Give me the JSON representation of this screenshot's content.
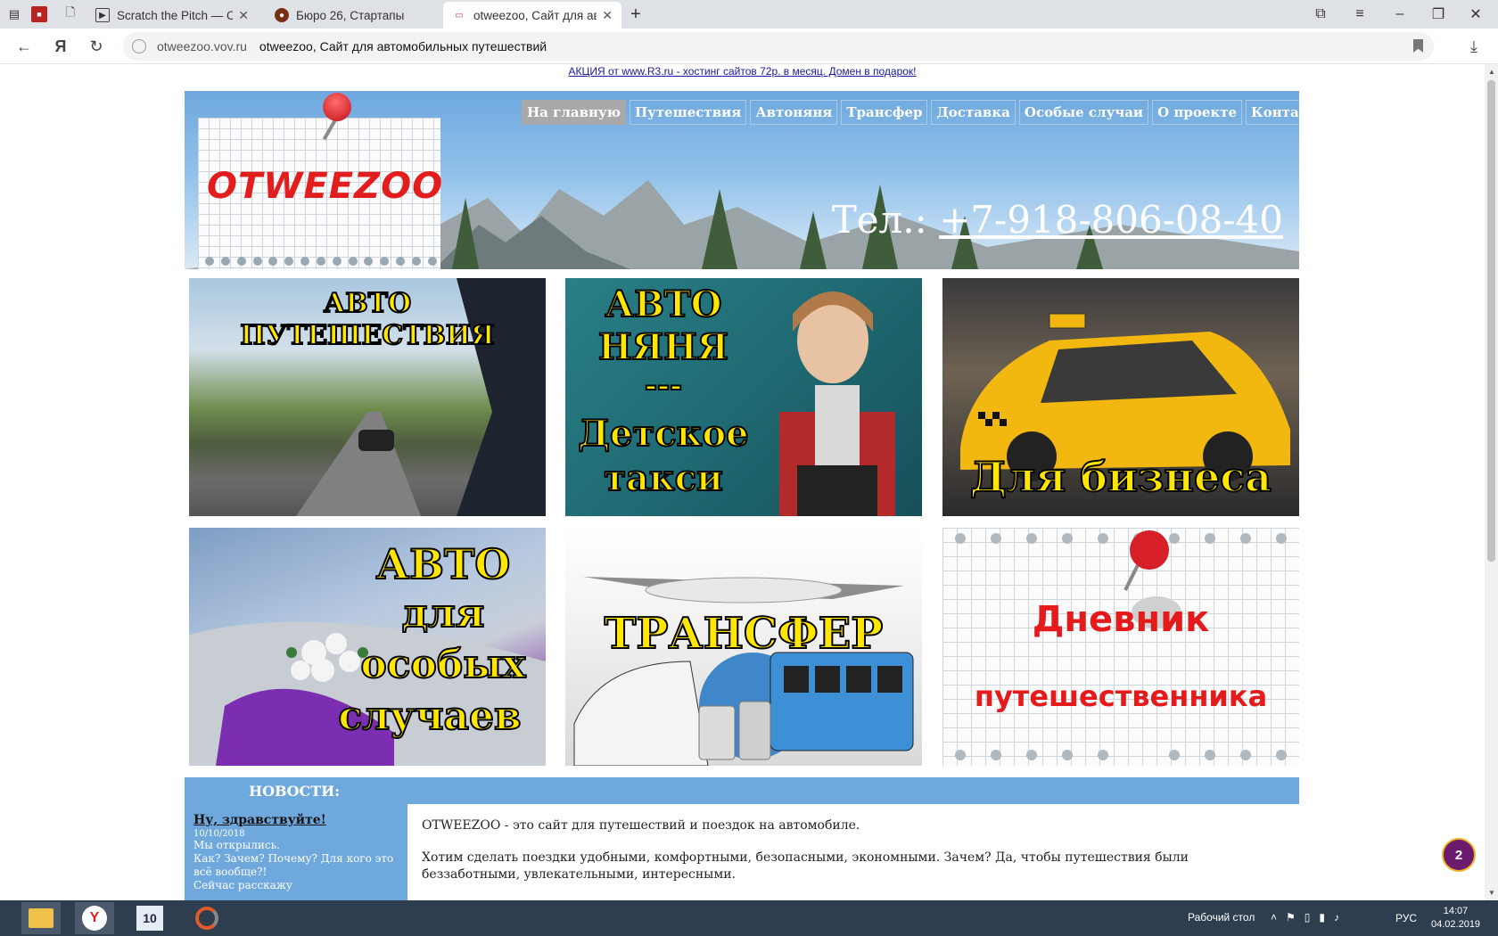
{
  "browser": {
    "tabs": [
      {
        "title": "Scratch the Pitch — Сл",
        "active": false
      },
      {
        "title": "Бюро 26, Стартапы",
        "active": false
      },
      {
        "title": "otweezoo, Сайт для авто",
        "active": true
      }
    ],
    "address": {
      "domain": "otweezoo.vov.ru",
      "page_title": "otweezoo, Сайт для автомобильных путешествий"
    },
    "yandex_glyph": "Я"
  },
  "page": {
    "promo": "АКЦИЯ от www.R3.ru - хостинг сайтов 72р. в месяц. Домен в подарок!",
    "logo_text": "OTWEEZOO",
    "menu": [
      {
        "label": "На главную",
        "active": true
      },
      {
        "label": "Путешествия",
        "active": false
      },
      {
        "label": "Автоняня",
        "active": false
      },
      {
        "label": "Трансфер",
        "active": false
      },
      {
        "label": "Доставка",
        "active": false
      },
      {
        "label": "Особые случаи",
        "active": false
      },
      {
        "label": "О проекте",
        "active": false
      },
      {
        "label": "Контакты",
        "active": false
      }
    ],
    "phone_prefix": "Тел.: ",
    "phone_number": "+7-918-806-08-40",
    "tiles": {
      "t1": [
        "АВТО",
        "ПУТЕШЕСТВИЯ"
      ],
      "t2": [
        "АВТО",
        "НЯНЯ",
        "---",
        "Детское",
        "такси"
      ],
      "t3": [
        "Для бизнеса"
      ],
      "t4": [
        "АВТО",
        "для",
        "особых",
        "случаев"
      ],
      "t5": [
        "ТРАНСФЕР"
      ],
      "t6": [
        "Дневник",
        "путешественника"
      ]
    },
    "news": {
      "heading": "НОВОСТИ:",
      "item_title": "Ну, здравствуйте!",
      "item_date": "10/10/2018",
      "item_lines": [
        "Мы открылись.",
        "Как? Зачем? Почему? Для кого это всё вообще?!",
        "Сейчас расскажу"
      ]
    },
    "content": [
      "OTWEEZOO - это сайт для путешествий и поездок на автомобиле.",
      "Хотим сделать поездки удобными, комфортными, безопасными, экономными. Зачем? Да, чтобы путешествия были беззаботными, увлекательными, интересными."
    ],
    "chat_badge": "2"
  },
  "taskbar": {
    "desktop_label": "Рабочий стол",
    "lang": "РУС",
    "time": "14:07",
    "date": "04.02.2019"
  },
  "colors": {
    "menu_active": "#a9a9a9",
    "news_bar": "#6fa8dc",
    "tile_caption": "#ffe600",
    "logo_red": "#e11d1d"
  }
}
